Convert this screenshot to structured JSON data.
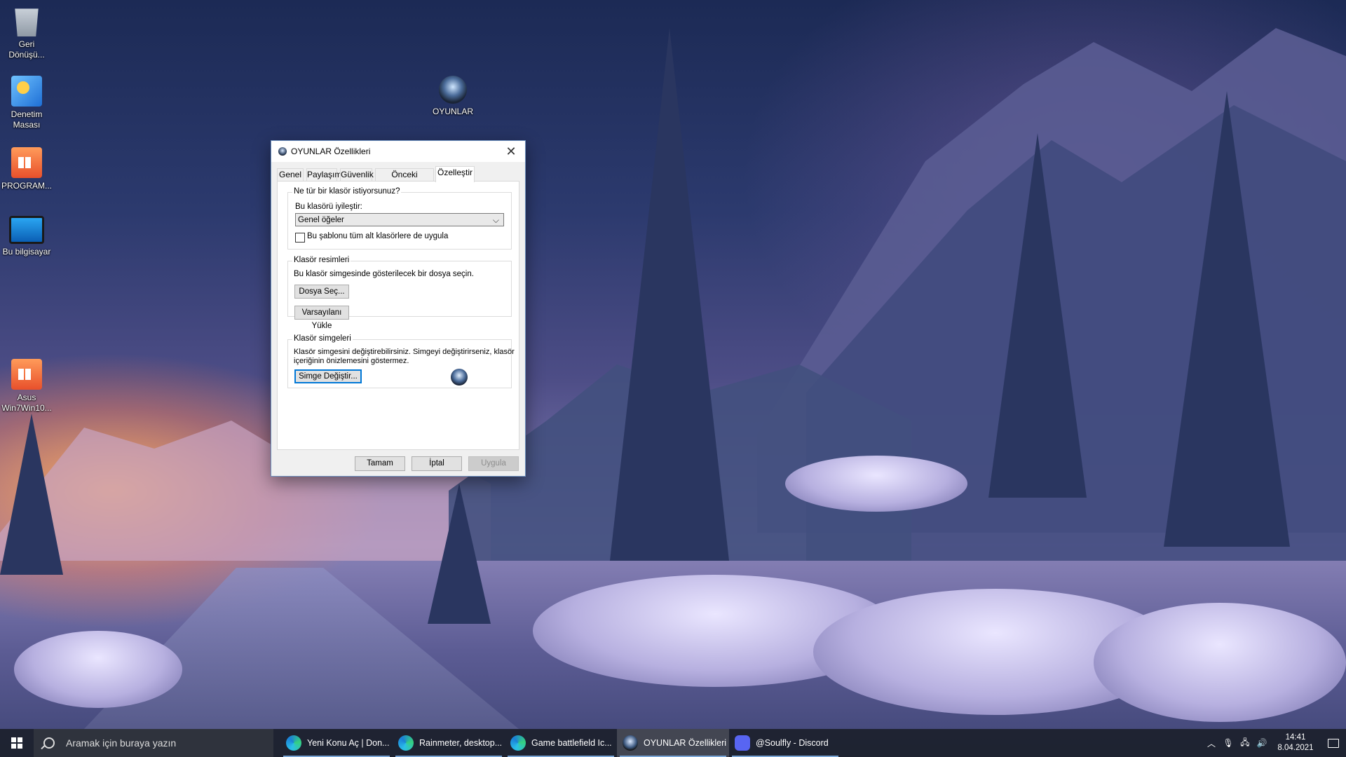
{
  "desktop": {
    "icons": [
      {
        "label": "Geri Dönüşü...",
        "icon": "recycle-bin-icon"
      },
      {
        "label": "Denetim Masası",
        "icon": "control-panel-icon"
      },
      {
        "label": "PROGRAM...",
        "icon": "folder-icon"
      },
      {
        "label": "Bu bilgisayar",
        "icon": "computer-icon"
      },
      {
        "label": "Asus Win7Win10...",
        "icon": "folder-icon"
      },
      {
        "label": "OYUNLAR",
        "icon": "game-folder-icon"
      }
    ]
  },
  "dialog": {
    "title": "OYUNLAR Özellikleri",
    "tabs": [
      "Genel",
      "Paylaşım",
      "Güvenlik",
      "Önceki Sürümler",
      "Özelleştir"
    ],
    "active_tab": "Özelleştir",
    "group1": {
      "legend": "Ne tür bir klasör istiyorsunuz?",
      "optimize_label": "Bu klasörü iyileştir:",
      "optimize_value": "Genel öğeler",
      "checkbox_label": "Bu şablonu tüm alt klasörlere de uygula",
      "checkbox_checked": false
    },
    "group2": {
      "legend": "Klasör resimleri",
      "desc": "Bu klasör simgesinde gösterilecek bir dosya seçin.",
      "choose_file": "Dosya Seç...",
      "restore_default": "Varsayılanı Yükle"
    },
    "group3": {
      "legend": "Klasör simgeleri",
      "desc_line1": "Klasör simgesini değiştirebilirsiniz. Simgeyi değiştirirseniz, klasör",
      "desc_line2": "içeriğinin önizlemesini göstermez.",
      "change_icon": "Simge Değiştir..."
    },
    "buttons": {
      "ok": "Tamam",
      "cancel": "İptal",
      "apply": "Uygula"
    }
  },
  "taskbar": {
    "search_placeholder": "Aramak için buraya yazın",
    "tasks": [
      {
        "label": "Yeni Konu Aç | Don...",
        "icon": "edge-icon"
      },
      {
        "label": "Rainmeter, desktop...",
        "icon": "edge-icon"
      },
      {
        "label": "Game battlefield Ic...",
        "icon": "edge-icon"
      },
      {
        "label": "OYUNLAR Özellikleri",
        "icon": "folder-icon"
      },
      {
        "label": "@Soulfly - Discord",
        "icon": "discord-icon"
      }
    ],
    "clock_time": "14:41",
    "clock_date": "8.04.2021"
  },
  "colors": {
    "accent": "#0078d7",
    "taskbar": "#1c202c"
  }
}
